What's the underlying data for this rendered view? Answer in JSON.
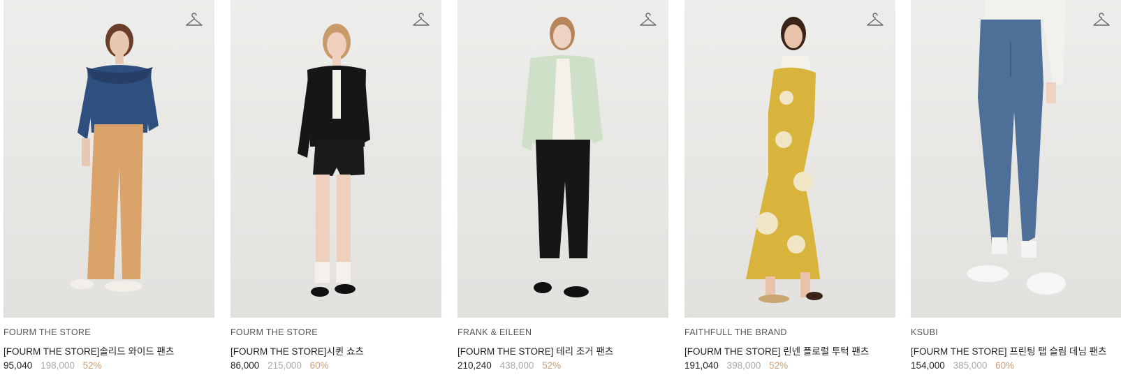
{
  "products": [
    {
      "brand": "FOURM THE STORE",
      "name": "[FOURM THE STORE]솔리드 와이드 팬츠",
      "sale_price": "95,040",
      "original_price": "198,000",
      "discount": "52%"
    },
    {
      "brand": "FOURM THE STORE",
      "name": "[FOURM THE STORE]시퀸 쇼츠",
      "sale_price": "86,000",
      "original_price": "215,000",
      "discount": "60%"
    },
    {
      "brand": "FRANK & EILEEN",
      "name": "[FOURM THE STORE] 테리 조거 팬츠",
      "sale_price": "210,240",
      "original_price": "438,000",
      "discount": "52%"
    },
    {
      "brand": "FAITHFULL THE BRAND",
      "name": "[FOURM THE STORE] 린넨 플로럴 투턱 팬츠",
      "sale_price": "191,040",
      "original_price": "398,000",
      "discount": "52%"
    },
    {
      "brand": "KSUBI",
      "name": "[FOURM THE STORE] 프린팅 탭 슬림 데님 팬츠",
      "sale_price": "154,000",
      "original_price": "385,000",
      "discount": "60%"
    }
  ],
  "icons": {
    "wishlist": "hanger-icon"
  },
  "colors": {
    "discount": "#c9a07a",
    "original_price": "#a9a9a9",
    "photo_bg": "#e8e7e4"
  }
}
